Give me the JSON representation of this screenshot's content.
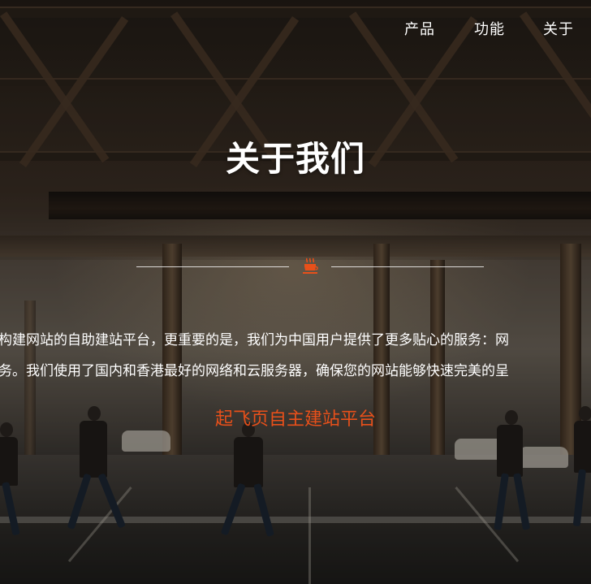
{
  "nav": {
    "items": [
      {
        "label": "产品"
      },
      {
        "label": "功能"
      },
      {
        "label": "关于"
      }
    ]
  },
  "hero": {
    "title": "关于我们",
    "divider_icon": "coffee-cup-icon",
    "paragraph_lines": [
      "构建网站的自助建站平台，更重要的是，我们为中国用户提供了更多贴心的服务：网",
      "务。我们使用了国内和香港最好的网络和云服务器，确保您的网站能够快速完美的呈"
    ],
    "tagline": "起飞页自主建站平台"
  },
  "colors": {
    "accent": "#e8501a",
    "text": "#ffffff"
  }
}
